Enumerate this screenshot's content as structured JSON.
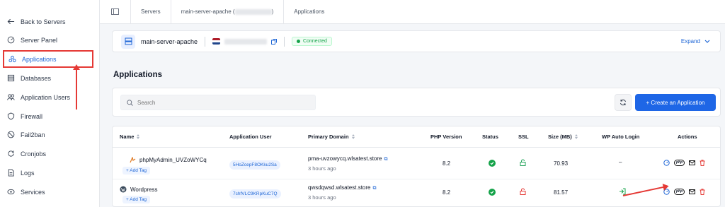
{
  "sidebar": {
    "items": [
      {
        "label": "Back to Servers",
        "icon": "arrow-left-icon"
      },
      {
        "label": "Server Panel",
        "icon": "dashboard-icon"
      },
      {
        "label": "Applications",
        "icon": "applications-icon",
        "active": true
      },
      {
        "label": "Databases",
        "icon": "database-icon"
      },
      {
        "label": "Application Users",
        "icon": "users-icon"
      },
      {
        "label": "Firewall",
        "icon": "shield-icon"
      },
      {
        "label": "Fail2ban",
        "icon": "ban-icon"
      },
      {
        "label": "Cronjobs",
        "icon": "refresh-icon"
      },
      {
        "label": "Logs",
        "icon": "file-icon"
      },
      {
        "label": "Services",
        "icon": "services-icon"
      }
    ]
  },
  "breadcrumb": {
    "servers": "Servers",
    "server": "main-server-apache (",
    "server_close": ")",
    "page": "Applications"
  },
  "server": {
    "name": "main-server-apache",
    "status": "Connected",
    "expand": "Expand"
  },
  "main": {
    "title": "Applications",
    "search_placeholder": "Search",
    "create_button": "+ Create an Application"
  },
  "table": {
    "headers": {
      "name": "Name",
      "user": "Application User",
      "domain": "Primary Domain",
      "php": "PHP Version",
      "status": "Status",
      "ssl": "SSL",
      "size": "Size (MB)",
      "wp": "WP Auto Login",
      "actions": "Actions"
    },
    "rows": [
      {
        "name": "phpMyAdmin_UVZoWYCq",
        "tag": "+ Add Tag",
        "user": "5HoZcepF8OKku2Sa",
        "domain": "pma-uvzowycq.wlsatest.store",
        "time": "3 hours ago",
        "php": "8.2",
        "size": "70.93",
        "wp": "–"
      },
      {
        "name": "Wordpress",
        "tag": "+ Add Tag",
        "user": "7chfVLC9KRpKuC7Q",
        "domain": "qwsdqwsd.wlsatest.store",
        "time": "3 hours ago",
        "php": "8.2",
        "size": "81.57",
        "wp": ""
      }
    ]
  },
  "colors": {
    "accent": "#1e66e6",
    "success": "#16a34a",
    "danger": "#e53935",
    "ssl_on": "#22a35a",
    "ssl_off": "#e53935"
  }
}
